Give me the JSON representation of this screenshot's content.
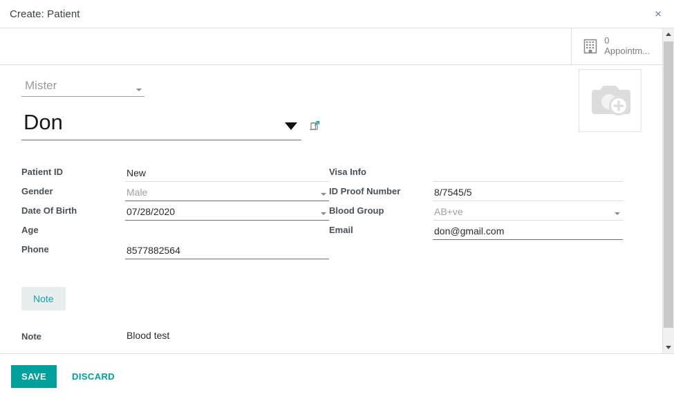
{
  "dialog": {
    "title": "Create: Patient",
    "close_icon": "close-icon",
    "close_label": "×"
  },
  "stat_buttons": [
    {
      "icon": "building-icon",
      "value": "0",
      "label": "Appointm..."
    }
  ],
  "photo": {
    "icon": "camera-add-icon",
    "alt": "Add photo"
  },
  "title_field": {
    "value": "Mister",
    "placeholder": "Title",
    "caret_icon": "chevron-down-icon"
  },
  "name_field": {
    "value": "Don",
    "placeholder": "Name",
    "caret_icon": "chevron-down-icon",
    "external_link_icon": "external-link-icon"
  },
  "left_fields": [
    {
      "label": "Patient ID",
      "value": "New",
      "underline": "light",
      "dropdown": false,
      "muted": false
    },
    {
      "label": "Gender",
      "value": "Male",
      "underline": "dark",
      "dropdown": true,
      "muted": true
    },
    {
      "label": "Date Of Birth",
      "value": "07/28/2020",
      "underline": "dark",
      "dropdown": true,
      "muted": false
    },
    {
      "label": "Age",
      "value": "",
      "underline": "none",
      "dropdown": false,
      "muted": false
    },
    {
      "label": "Phone",
      "value": "8577882564",
      "underline": "dark",
      "dropdown": false,
      "muted": false
    }
  ],
  "right_fields": [
    {
      "label": "Visa Info",
      "value": "",
      "underline": "light",
      "dropdown": false,
      "muted": false
    },
    {
      "label": "ID Proof Number",
      "value": "8/7545/5",
      "underline": "light",
      "dropdown": false,
      "muted": false
    },
    {
      "label": "Blood Group",
      "value": "AB+ve",
      "underline": "light",
      "dropdown": true,
      "muted": true
    },
    {
      "label": "Email",
      "value": "don@gmail.com",
      "underline": "dark",
      "dropdown": false,
      "muted": false
    }
  ],
  "notebook": {
    "tabs": [
      {
        "label": "Note",
        "active": true
      }
    ],
    "note_field": {
      "label": "Note",
      "value": "Blood test",
      "placeholder": ""
    }
  },
  "footer": {
    "save_label": "SAVE",
    "discard_label": "DISCARD"
  },
  "scrollbar": {
    "up_icon": "chevron-up-icon",
    "down_icon": "chevron-down-icon"
  },
  "colors": {
    "accent": "#00a09d",
    "tab_bg": "#e8edef",
    "tab_text": "#15a0a8",
    "label": "#4a4f54",
    "border": "#dfdfdf"
  }
}
